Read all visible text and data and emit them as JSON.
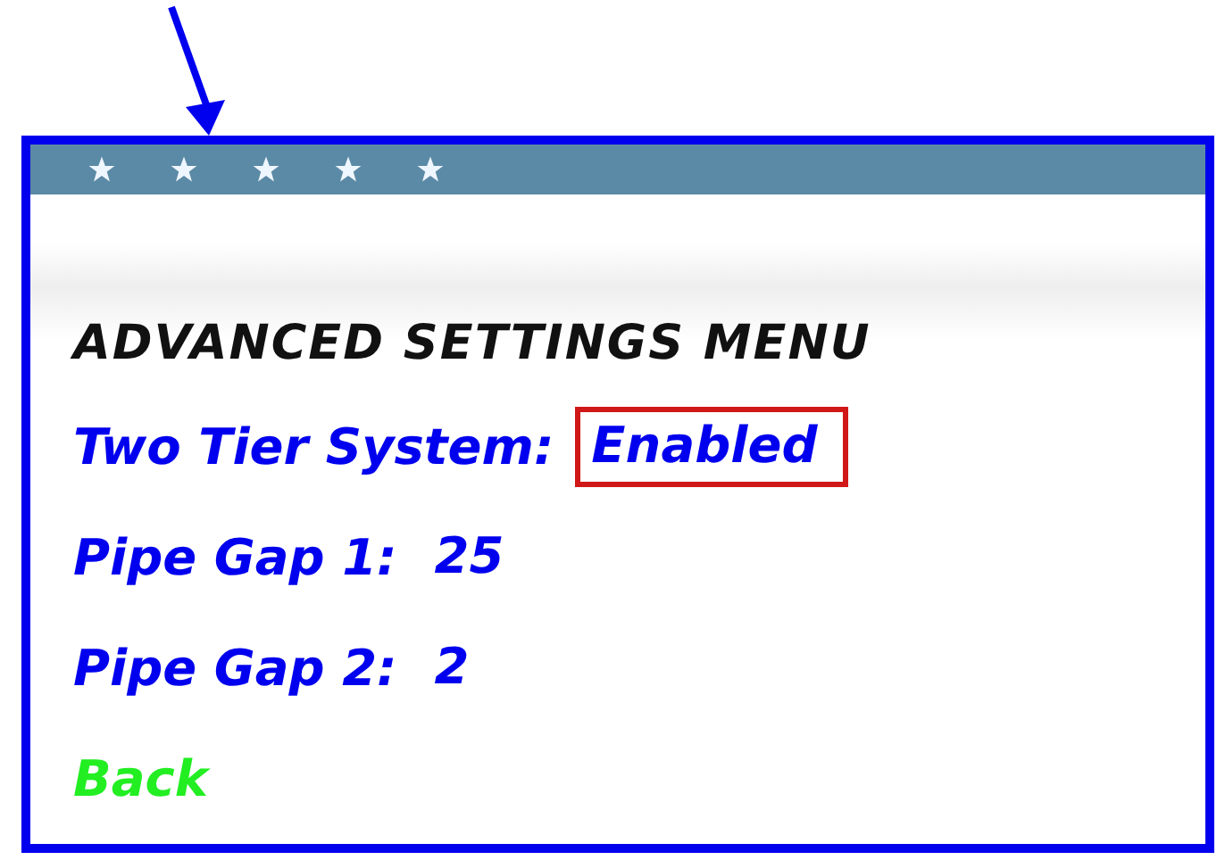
{
  "title": "ADVANCED SETTINGS MENU",
  "items": [
    {
      "kind": "setting",
      "label": "Two Tier System:",
      "value": "Enabled",
      "highlighted": true
    },
    {
      "kind": "setting",
      "label": "Pipe Gap 1:",
      "value": "25",
      "highlighted": false
    },
    {
      "kind": "setting",
      "label": "Pipe Gap 2:",
      "value": "2",
      "highlighted": false
    },
    {
      "kind": "back",
      "label": "Back"
    }
  ]
}
